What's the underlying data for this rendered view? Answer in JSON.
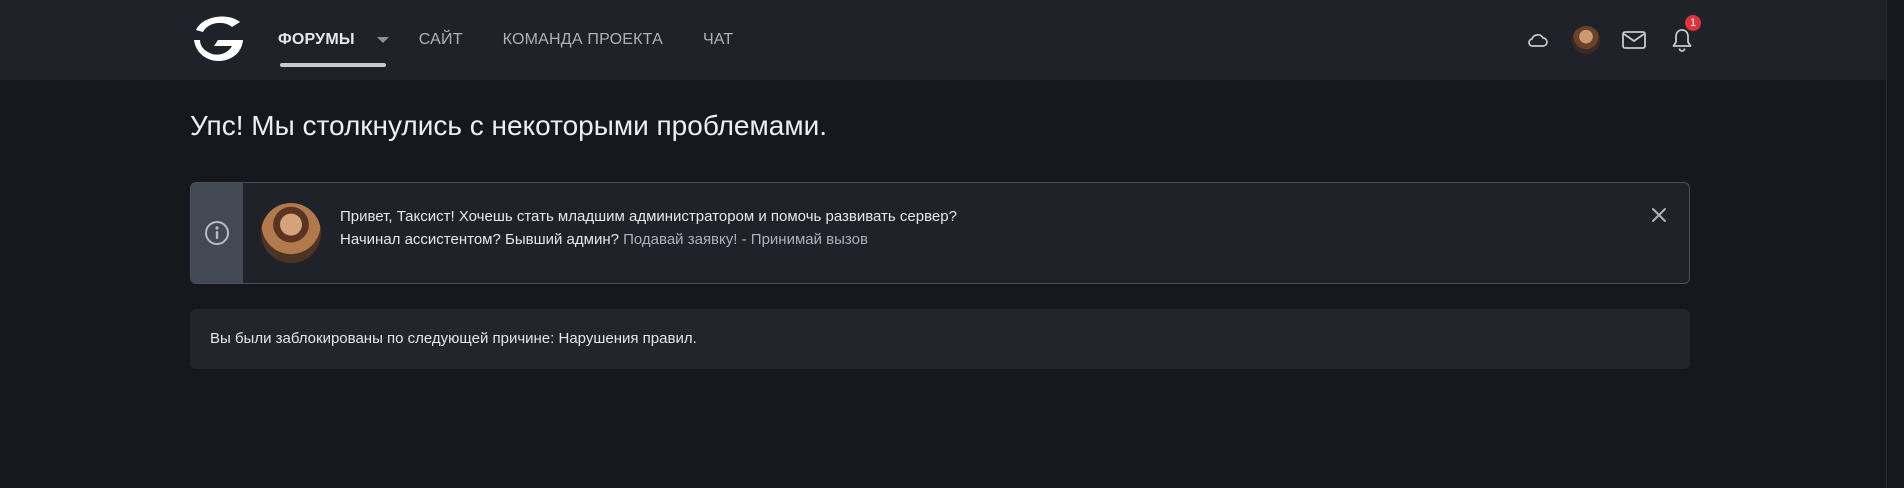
{
  "header": {
    "nav": [
      {
        "label": "ФОРУМЫ",
        "active": true
      },
      {
        "label": "САЙТ"
      },
      {
        "label": "КОМАНДА ПРОЕКТА"
      },
      {
        "label": "ЧАТ"
      }
    ],
    "icons": [
      "cloud-icon",
      "user-avatar",
      "mail-icon",
      "bell-icon"
    ],
    "notification_count": "1"
  },
  "page": {
    "title": "Упс! Мы столкнулись с некоторыми проблемами."
  },
  "notice": {
    "line1": "Привет, Таксист! Хочешь стать младшим администратором и помочь развивать сервер?",
    "line2_prefix": "Начинал ассистентом? Бывший админ?",
    "link1": "Подавай заявку!",
    "separator": "-",
    "link2": "Принимай вызов"
  },
  "block_message": "Вы были заблокированы по следующей причине: Нарушения правил.",
  "colors": {
    "background": "#17181d",
    "header": "#202229",
    "badge": "#e0323a"
  }
}
